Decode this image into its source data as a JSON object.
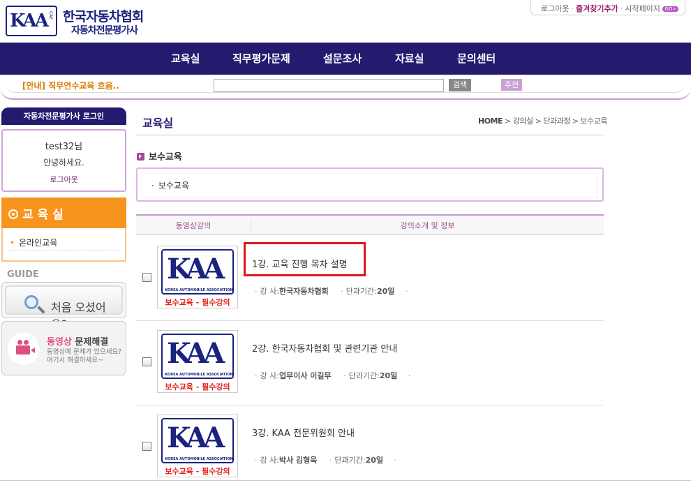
{
  "header": {
    "logo_text": "KAA",
    "logo_sub": "CAE",
    "brand_title": "한국자동차협회",
    "brand_subtitle": "자동차전문평가사",
    "top_links": [
      "로그아웃",
      "즐겨찾기추가",
      "시작페이지"
    ],
    "go_badge": "GO>"
  },
  "nav": {
    "items": [
      "교육실",
      "직무평가문제",
      "설문조사",
      "자료실",
      "문의센터"
    ]
  },
  "subbar": {
    "notice": "[안내] 직무연수교육 흐음..",
    "search_value": "",
    "search_button": "검색",
    "recommend_button": "추천"
  },
  "sidebar": {
    "login_title": "자동차전문평가사 로그인",
    "user": "test32님",
    "greeting": "안녕하세요.",
    "logout": "로그아웃",
    "edu_title": "교 육 실",
    "edu_items": [
      "온라인교육"
    ],
    "guide_label": "GUIDE",
    "first_visit": "처음 오셨어요?",
    "video_title_a": "동영상",
    "video_title_b": " 문제해결",
    "video_desc_1": "동영상에 문제가 있으세요?",
    "video_desc_2": "여기서 해결하세요~"
  },
  "main": {
    "title": "교육실",
    "breadcrumb": [
      "HOME",
      "강의실",
      "단과과정",
      "보수교육"
    ],
    "section_title": "보수교육",
    "section_box_item": "보수교육",
    "col_video": "동영상강의",
    "col_info": "강의소개 및 정보",
    "thumb_text": "KAA",
    "thumb_assoc": "KOREA AUTOMOBILE ASSOCIATION",
    "thumb_caption": "보수교육 - 필수강의",
    "lectures": [
      {
        "title": "1강. 교육 진행 목차 설명",
        "instructor_label": "강 사:",
        "instructor": "한국자동차협회",
        "period_label": "단과기간:",
        "period": "20일"
      },
      {
        "title": "2강. 한국자동차협회 및 관련기관 안내",
        "instructor_label": "강 사:",
        "instructor": "업무이사 이길무",
        "period_label": "단과기간:",
        "period": "20일"
      },
      {
        "title": "3강. KAA 전문위원회 안내",
        "instructor_label": "강 사:",
        "instructor": "박사 김형욱",
        "period_label": "단과기간:",
        "period": "20일"
      }
    ]
  },
  "colors": {
    "nav_bg": "#241b6f",
    "accent_purple": "#c39acd",
    "edu_orange": "#f7941d",
    "highlight_red": "#e0141e"
  }
}
